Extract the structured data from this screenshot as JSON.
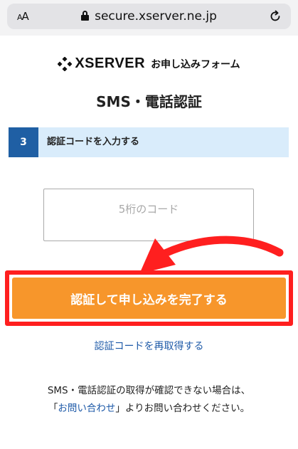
{
  "browser": {
    "text_size_label_small": "A",
    "text_size_label_large": "A",
    "url": "secure.xserver.ne.jp",
    "lock_icon": "lock-icon",
    "reload_icon": "reload-icon"
  },
  "header": {
    "logo_text": "XSERVER",
    "subtitle": "お申し込みフォーム"
  },
  "page": {
    "title": "SMS・電話認証"
  },
  "step": {
    "number": "3",
    "label": "認証コードを入力する"
  },
  "form": {
    "code_value": "",
    "code_placeholder": "5桁のコード",
    "submit_label": "認証して申し込みを完了する",
    "resend_label": "認証コードを再取得する"
  },
  "note": {
    "line1": "SMS・電話認証の取得が確認できない場合は、",
    "open_bracket": "「",
    "link_label": "お問い合わせ",
    "line2_suffix": "」よりお問い合わせください。"
  },
  "colors": {
    "accent_blue": "#1f5fa4",
    "step_bg": "#d9ecfb",
    "button_orange": "#f7962b",
    "highlight_red": "#ff1f1f",
    "link_blue": "#1e5aa8"
  }
}
